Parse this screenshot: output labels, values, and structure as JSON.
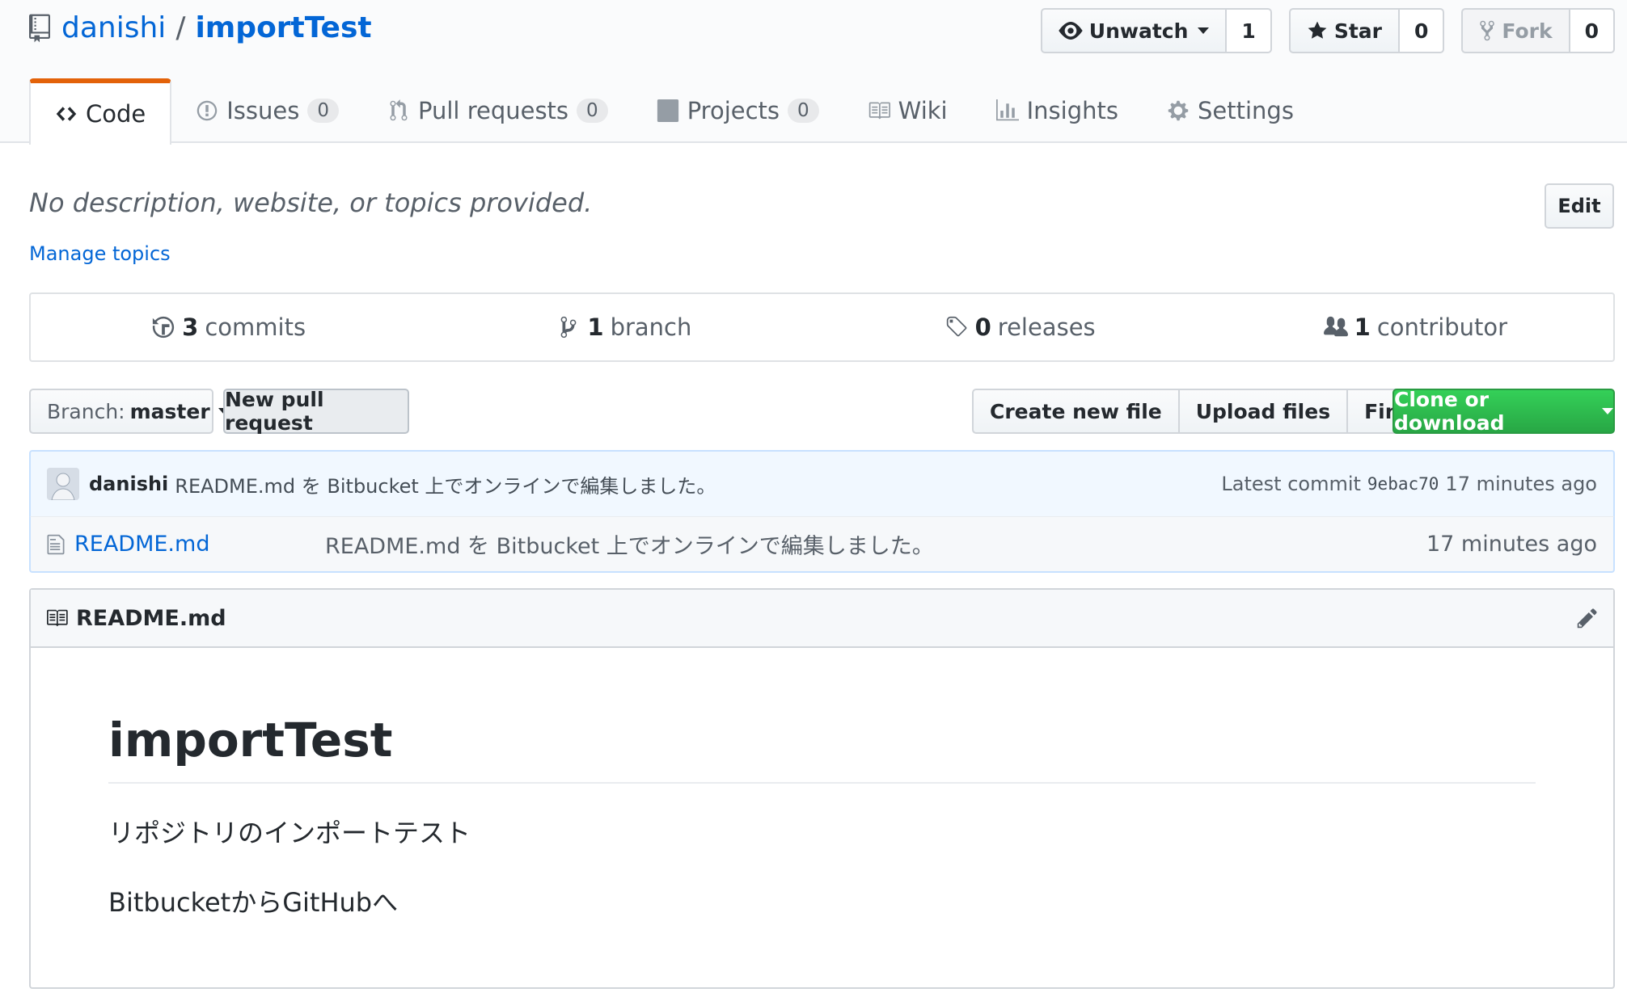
{
  "repo": {
    "owner": "danishi",
    "separator": "/",
    "name": "importTest"
  },
  "actions": {
    "watch": {
      "label": "Unwatch",
      "count": "1"
    },
    "star": {
      "label": "Star",
      "count": "0"
    },
    "fork": {
      "label": "Fork",
      "count": "0"
    }
  },
  "nav": {
    "code": "Code",
    "issues": {
      "label": "Issues",
      "count": "0"
    },
    "pulls": {
      "label": "Pull requests",
      "count": "0"
    },
    "projects": {
      "label": "Projects",
      "count": "0"
    },
    "wiki": "Wiki",
    "insights": "Insights",
    "settings": "Settings"
  },
  "description": "No description, website, or topics provided.",
  "manage_topics": "Manage topics",
  "edit_label": "Edit",
  "summary": {
    "commits": {
      "num": "3",
      "label": "commits"
    },
    "branches": {
      "num": "1",
      "label": "branch"
    },
    "releases": {
      "num": "0",
      "label": "releases"
    },
    "contributors": {
      "num": "1",
      "label": "contributor"
    }
  },
  "file_nav": {
    "branch_prefix": "Branch:",
    "branch_name": "master",
    "new_pr": "New pull request",
    "create_file": "Create new file",
    "upload_files": "Upload files",
    "find_file": "Find File",
    "clone": "Clone or download"
  },
  "latest_commit": {
    "author": "danishi",
    "message": "README.md を Bitbucket 上でオンラインで編集しました。",
    "label": "Latest commit",
    "sha": "9ebac70",
    "age": "17 minutes ago"
  },
  "files": [
    {
      "name": "README.md",
      "message": "README.md を Bitbucket 上でオンラインで編集しました。",
      "age": "17 minutes ago"
    }
  ],
  "readme": {
    "filename": "README.md",
    "heading": "importTest",
    "paragraphs": [
      "リポジトリのインポートテスト",
      "BitbucketからGitHubへ"
    ]
  },
  "colors": {
    "accent": "#0366d6",
    "tab_underline": "#e36209",
    "clone_green": "#28a745"
  }
}
